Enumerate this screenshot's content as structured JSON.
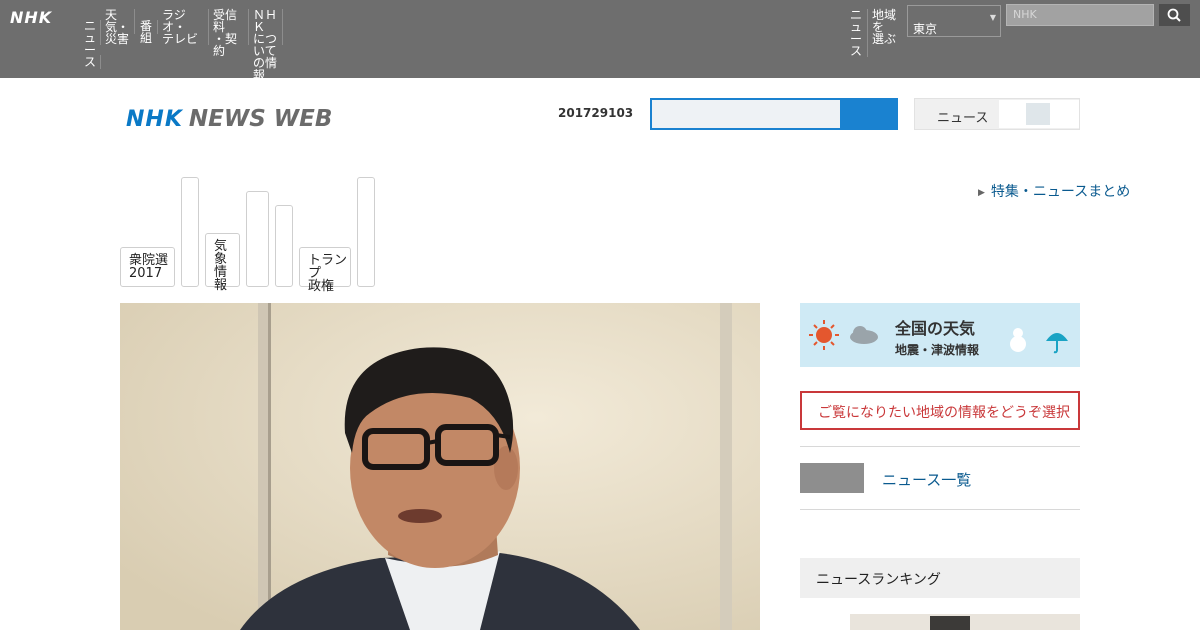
{
  "global_bar": {
    "logo": "NHK",
    "nav": [
      {
        "label": "ニュ\nース"
      },
      {
        "label": "天気・\n災害"
      },
      {
        "label": "番組"
      },
      {
        "label": "ラジオ・\nテレビ"
      },
      {
        "label": "受信料\n・契約"
      },
      {
        "label": "ＮＨＫ\nについて\nの情報"
      }
    ],
    "right_nav": [
      {
        "label": "ニュ\nース"
      },
      {
        "label": "地域を\n選ぶ"
      }
    ],
    "region_select": "東京",
    "search_placeholder": "NHK",
    "search_icon": "search-icon"
  },
  "header": {
    "logo_nhk": "NHK",
    "logo_news": "NEWS WEB",
    "date": "201729103",
    "search_placeholder": "",
    "language_label": "ニュース"
  },
  "categories": [
    {
      "label": "衆院選\n2017"
    },
    {
      "label": ""
    },
    {
      "label": "気象\n情報"
    },
    {
      "label": ""
    },
    {
      "label": ""
    },
    {
      "label": "トランプ\n政権"
    },
    {
      "label": ""
    }
  ],
  "special_link": "特集・ニュースまとめ",
  "sidebar": {
    "weather_title": "全国の天気",
    "weather_sub": "地震・津波情報",
    "alert_text": "ご覧になりたい地域の情報をどうぞ選択",
    "link_label": "ニュース一覧",
    "box_title": "ニュースランキング"
  },
  "colors": {
    "global_bar": "#6e6e6e",
    "brand_blue": "#0a79c6",
    "link_blue": "#0a5a8f",
    "alert_red": "#c9383a"
  }
}
